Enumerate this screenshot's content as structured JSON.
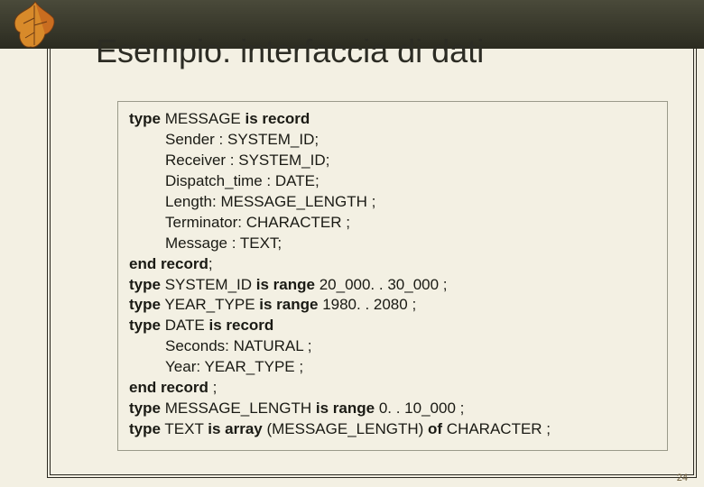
{
  "title": "Esempio: interfaccia di dati",
  "page_number": "24",
  "code": {
    "l1a": "type",
    "l1b": " MESSAGE ",
    "l1c": "is record",
    "l2": "Sender : SYSTEM_ID;",
    "l3": "Receiver : SYSTEM_ID;",
    "l4": "Dispatch_time : DATE;",
    "l5": "Length: MESSAGE_LENGTH ;",
    "l6": "Terminator: CHARACTER ;",
    "l7": "Message : TEXT;",
    "l8a": "end record",
    "l8b": ";",
    "l9a": "type",
    "l9b": " SYSTEM_ID ",
    "l9c": "is range",
    "l9d": " 20_000. . 30_000 ;",
    "l10a": "type",
    "l10b": " YEAR_TYPE ",
    "l10c": "is range",
    "l10d": " 1980. . 2080 ;",
    "l11a": "type",
    "l11b": " DATE ",
    "l11c": "is record",
    "l12": "Seconds: NATURAL ;",
    "l13": "Year: YEAR_TYPE ;",
    "l14a": "end record",
    "l14b": " ;",
    "l15a": "type",
    "l15b": " MESSAGE_LENGTH ",
    "l15c": "is range",
    "l15d": " 0. . 10_000 ;",
    "l16a": "type",
    "l16b": " TEXT ",
    "l16c": "is array",
    "l16d": " (MESSAGE_LENGTH) ",
    "l16e": "of",
    "l16f": " CHARACTER ;"
  }
}
